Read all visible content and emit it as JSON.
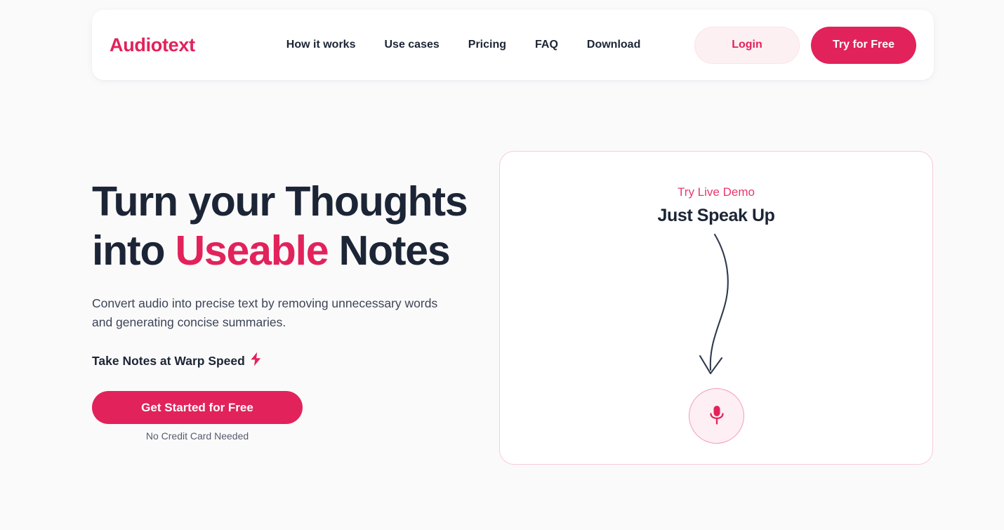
{
  "theme": {
    "brand_pink": "#e2225b",
    "dark_navy": "#1c2535",
    "page_background": "#fbfafb",
    "card_border_pink": "#f7ccd8",
    "soft_pink_fill": "#fdf0f3"
  },
  "navbar": {
    "brand": "Audiotext",
    "links": [
      {
        "label": "How it works"
      },
      {
        "label": "Use cases"
      },
      {
        "label": "Pricing"
      },
      {
        "label": "FAQ"
      },
      {
        "label": "Download"
      }
    ],
    "login_label": "Login",
    "try_label": "Try for Free"
  },
  "hero": {
    "title_line1": "Turn your Thoughts",
    "title_line2_prefix": "into ",
    "title_line2_accent": "Useable",
    "title_line2_suffix": " Notes",
    "subtitle": "Convert audio into precise text by removing unnecessary words and generating concise summaries.",
    "tagline": "Take Notes at Warp Speed",
    "tagline_icon": "lightning-bolt-icon",
    "cta_label": "Get Started for Free",
    "cta_note": "No Credit Card Needed"
  },
  "demo_card": {
    "eyebrow": "Try Live Demo",
    "heading": "Just Speak Up",
    "arrow_icon": "curved-down-arrow-icon",
    "mic_icon": "microphone-icon"
  }
}
